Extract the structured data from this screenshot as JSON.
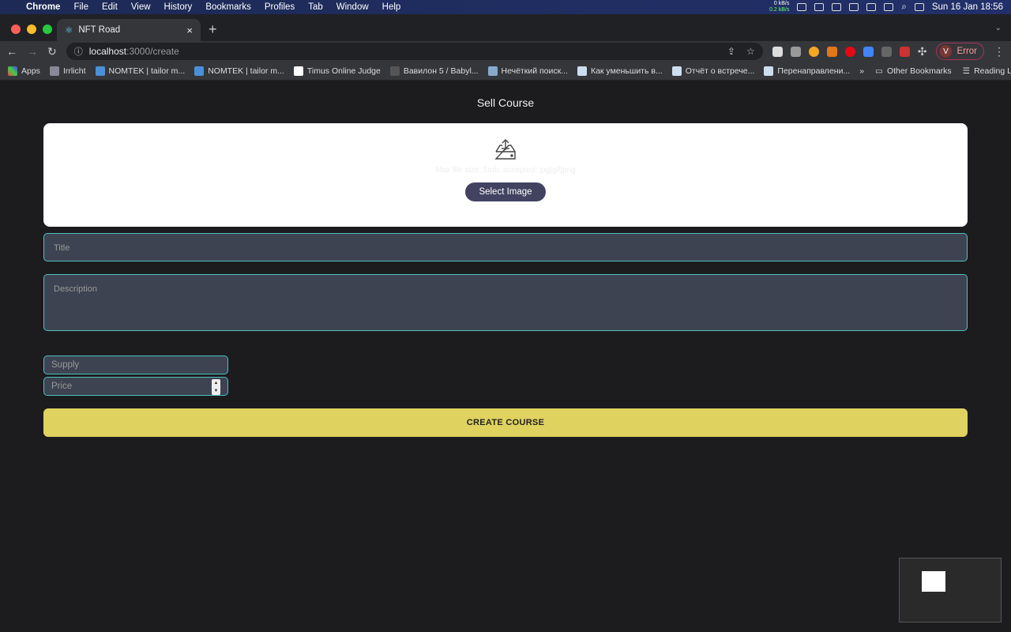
{
  "menubar": {
    "app": "Chrome",
    "items": [
      "File",
      "Edit",
      "View",
      "History",
      "Bookmarks",
      "Profiles",
      "Tab",
      "Window",
      "Help"
    ],
    "net_up": "0 kB/s",
    "net_down": "0.2 kB/s",
    "datetime": "Sun 16 Jan  18:56"
  },
  "tab": {
    "title": "NFT Road"
  },
  "omnibox": {
    "host": "localhost",
    "path": ":3000/create"
  },
  "profile": {
    "initial": "V",
    "label": "Error"
  },
  "bookmarks": {
    "items": [
      "Apps",
      "Irrlicht",
      "NOMTEK | tailor m...",
      "NOMTEK | tailor m...",
      "Timus Online Judge",
      "Вавилон 5 / Babyl...",
      "Нечёткий поиск...",
      "Как уменьшить в...",
      "Отчёт о встрече...",
      "Перенаправлени..."
    ],
    "more": "»",
    "other": "Other Bookmarks",
    "reading": "Reading List"
  },
  "form": {
    "heading": "Sell Course",
    "upload_hint": "Max file size: 5mb, accepted: jpg|gif|png",
    "select_image": "Select Image",
    "title_placeholder": "Title",
    "description_placeholder": "Description",
    "supply_placeholder": "Supply",
    "price_placeholder": "Price",
    "submit": "CREATE COURSE"
  },
  "colors": {
    "accent": "#e0d25f",
    "input_border": "#4fc0c0",
    "button": "#414360"
  }
}
